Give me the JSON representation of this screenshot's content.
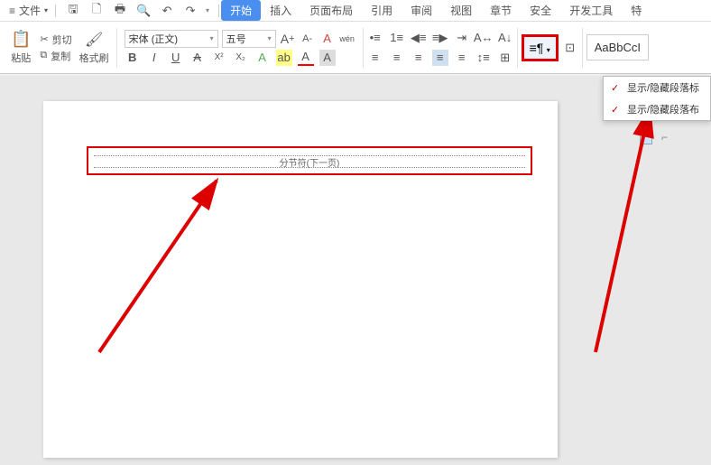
{
  "menubar": {
    "file": "文件",
    "tabs": [
      "开始",
      "插入",
      "页面布局",
      "引用",
      "审阅",
      "视图",
      "章节",
      "安全",
      "开发工具",
      "特"
    ]
  },
  "clipboard": {
    "paste": "粘贴",
    "cut": "剪切",
    "copy": "复制",
    "brush": "格式刷"
  },
  "font": {
    "name": "宋体 (正文)",
    "size": "五号",
    "increase": "A",
    "decrease": "A",
    "clear": "A",
    "phonetic": "wén",
    "bold": "B",
    "italic": "I",
    "underline": "U",
    "strike": "A",
    "superscript": "X²",
    "subscript": "X₂",
    "effects": "A",
    "highlight": "ab",
    "color": "A",
    "bg": "A"
  },
  "paragraph": {
    "toggle_formatting": "¶"
  },
  "styles": {
    "sample": "AaBbCcI"
  },
  "dropdown": {
    "item1": "显示/隐藏段落标",
    "item2": "显示/隐藏段落布"
  },
  "document": {
    "section_break": "分节符(下一页)"
  }
}
